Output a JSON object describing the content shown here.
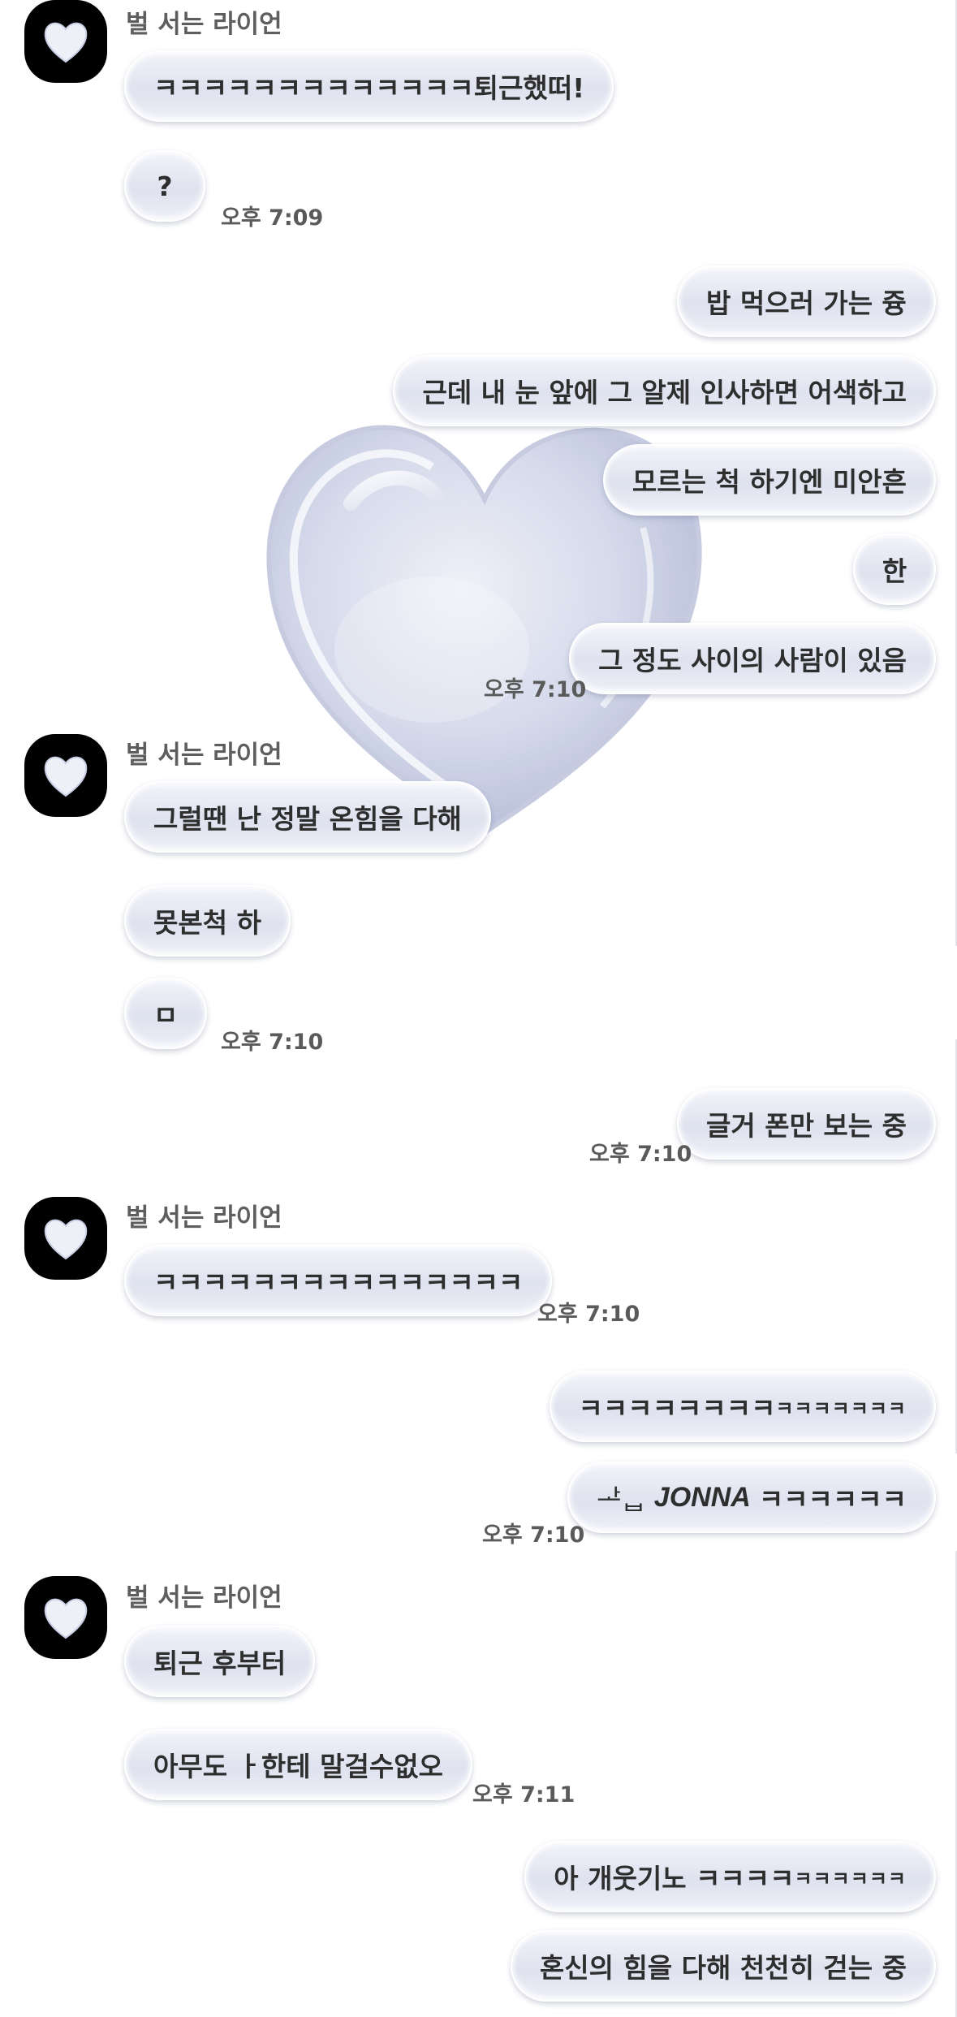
{
  "chat": {
    "sender_name": "벌 서는 라이언",
    "group1": {
      "msg1": "ㅋㅋㅋㅋㅋㅋㅋㅋㅋㅋㅋㅋㅋ퇴근했떠!",
      "msg2": "?",
      "time": "오후 7:09"
    },
    "group2": {
      "msg1": "밥 먹으러 가는 즁",
      "msg2": "근데 내 눈 앞에 그 알제 인사하면 어색하고",
      "msg3": "모르는 척 하기엔 미안흔",
      "msg4": "한",
      "msg5": "그 정도 사이의 사람이 있음",
      "time": "오후 7:10"
    },
    "group3": {
      "msg1": "그럴땐 난 정말 온힘을 다해",
      "msg2": "못본척 하",
      "msg3": "ㅁ",
      "time": "오후 7:10"
    },
    "group4": {
      "msg1": "글거 폰만 보는 중",
      "time": "오후 7:10"
    },
    "group5": {
      "msg1": "ㅋㅋㅋㅋㅋㅋㅋㅋㅋㅋㅋㅋㅋㅋㅋ",
      "time": "오후 7:10"
    },
    "group6": {
      "msg1_big": "ㅋㅋㅋㅋㅋㅋㅋㅋ",
      "msg1_small": "ㅋㅋㅋㅋㅋㅋㅋ",
      "msg2_prefix": "ᅶᆸ",
      "msg2_word": "JONNA",
      "msg2_suffix": "ㅋㅋㅋㅋㅋㅋ",
      "time": "오후 7:10"
    },
    "group7": {
      "msg1": "퇴근 후부터",
      "msg2": "아무도 ㅏ한테 말걸수없오",
      "time": "오후 7:11"
    },
    "group8": {
      "msg1_big": "아 개웃기노 ㅋㅋㅋㅋ",
      "msg1_small": "ㅋㅋㅋㅋㅋㅋ",
      "msg2": "혼신의 힘을 다해 천천히 걷는 중"
    }
  },
  "icons": {
    "avatar": "heart-icon",
    "background_decoration": "glass-heart"
  },
  "colors": {
    "background": "#ffffff",
    "bubble_top": "#f2f3f9",
    "bubble_mid": "#dfe2ef",
    "text": "#2e2e2e",
    "name_text": "#5e5e5e",
    "avatar_bg": "#000000"
  }
}
